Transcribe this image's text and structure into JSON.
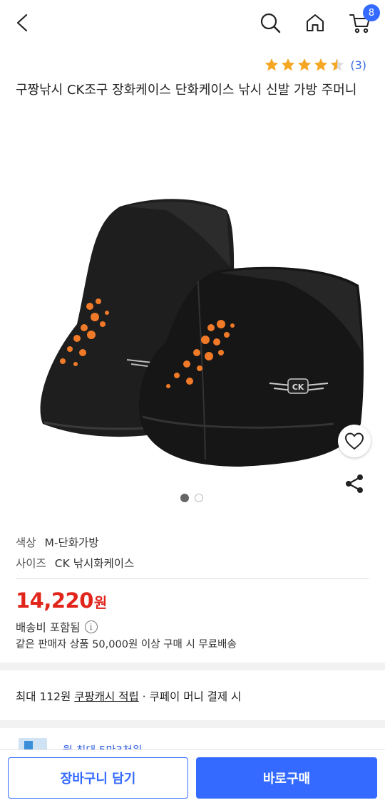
{
  "header": {
    "cart_count": "8"
  },
  "rating": {
    "stars": 4.5,
    "count_text": "(3)"
  },
  "product": {
    "title": "구짱낚시 CK조구 장화케이스 단화케이스 낚시 신발 가방 주머니",
    "image_count": 2,
    "image_index": 1,
    "logo_text": "CK"
  },
  "options": [
    {
      "label": "색상",
      "value": "M-단화가방"
    },
    {
      "label": "사이즈",
      "value": "CK 낚시화케이스"
    }
  ],
  "price": {
    "amount": "14,220",
    "unit": "원"
  },
  "shipping": {
    "included": "배송비 포함됨",
    "info_icon": "i",
    "free_condition": "같은 판매자 상품 50,000원 이상 구매 시 무료배송"
  },
  "cash": {
    "prefix": "최대 112원",
    "link": "쿠팡캐시 적립",
    "suffix": " · 쿠페이 머니 결제 시"
  },
  "promo": {
    "text": "월 최대 5만3천원"
  },
  "actions": {
    "add_to_cart": "장바구니 담기",
    "buy_now": "바로구매"
  },
  "colors": {
    "accent": "#346aff",
    "price": "#e1251b",
    "star": "#f5a623"
  }
}
